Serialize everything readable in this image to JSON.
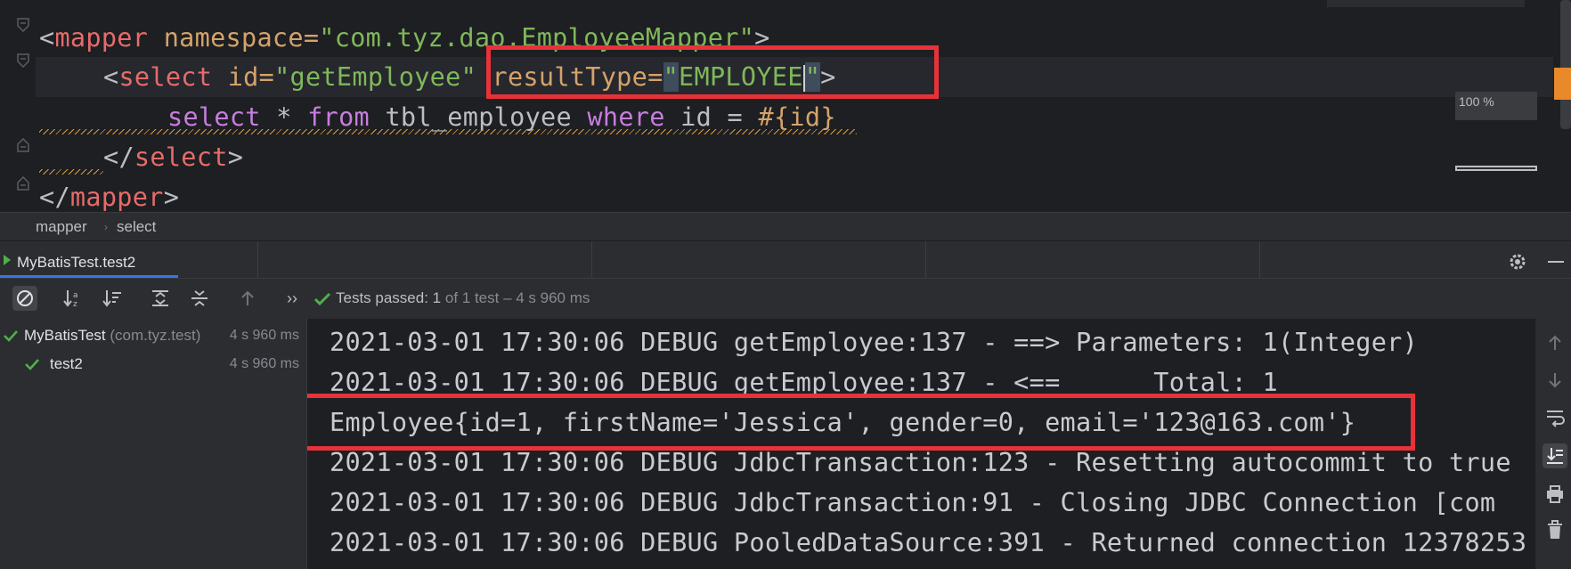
{
  "editor": {
    "lines": [
      {
        "parts": [
          "<",
          "mapper",
          " namespace=",
          "\"com.tyz.dao.EmployeeMapper\"",
          ">"
        ]
      },
      {
        "parts": [
          "<",
          "select",
          " id=",
          "\"getEmployee\"",
          " resultType=",
          "\"",
          "EMPLOYEE",
          "\"",
          ">"
        ]
      },
      {
        "parts": [
          "select",
          " * ",
          "from",
          " tbl_employee ",
          "where",
          " id = ",
          "#{id}"
        ]
      },
      {
        "parts": [
          "</",
          "select",
          ">"
        ]
      },
      {
        "parts": [
          "</",
          "mapper",
          ">"
        ]
      }
    ],
    "zoom": "100 %"
  },
  "breadcrumb": [
    "mapper",
    "select"
  ],
  "run_tab": {
    "label": "MyBatisTest.test2"
  },
  "status": {
    "prefix": "Tests passed: ",
    "count": "1",
    "suffix": " of 1 test – 4 s 960 ms"
  },
  "tree": [
    {
      "name": "MyBatisTest",
      "pkg": " (com.tyz.test)",
      "time": "4 s 960 ms"
    },
    {
      "name": "test2",
      "pkg": "",
      "time": "4 s 960 ms"
    }
  ],
  "console": [
    "2021-03-01 17:30:06 DEBUG getEmployee:137 - ==> Parameters: 1(Integer)",
    "2021-03-01 17:30:06 DEBUG getEmployee:137 - <==      Total: 1",
    "Employee{id=1, firstName='Jessica', gender=0, email='123@163.com'}",
    "2021-03-01 17:30:06 DEBUG JdbcTransaction:123 - Resetting autocommit to true",
    "2021-03-01 17:30:06 DEBUG JdbcTransaction:91 - Closing JDBC Connection [com",
    "2021-03-01 17:30:06 DEBUG PooledDataSource:391 - Returned connection 12378253"
  ],
  "colors": {
    "highlight_box": "#e8323a",
    "pass_green": "#4eb04a",
    "tab_underline": "#3574f0"
  }
}
